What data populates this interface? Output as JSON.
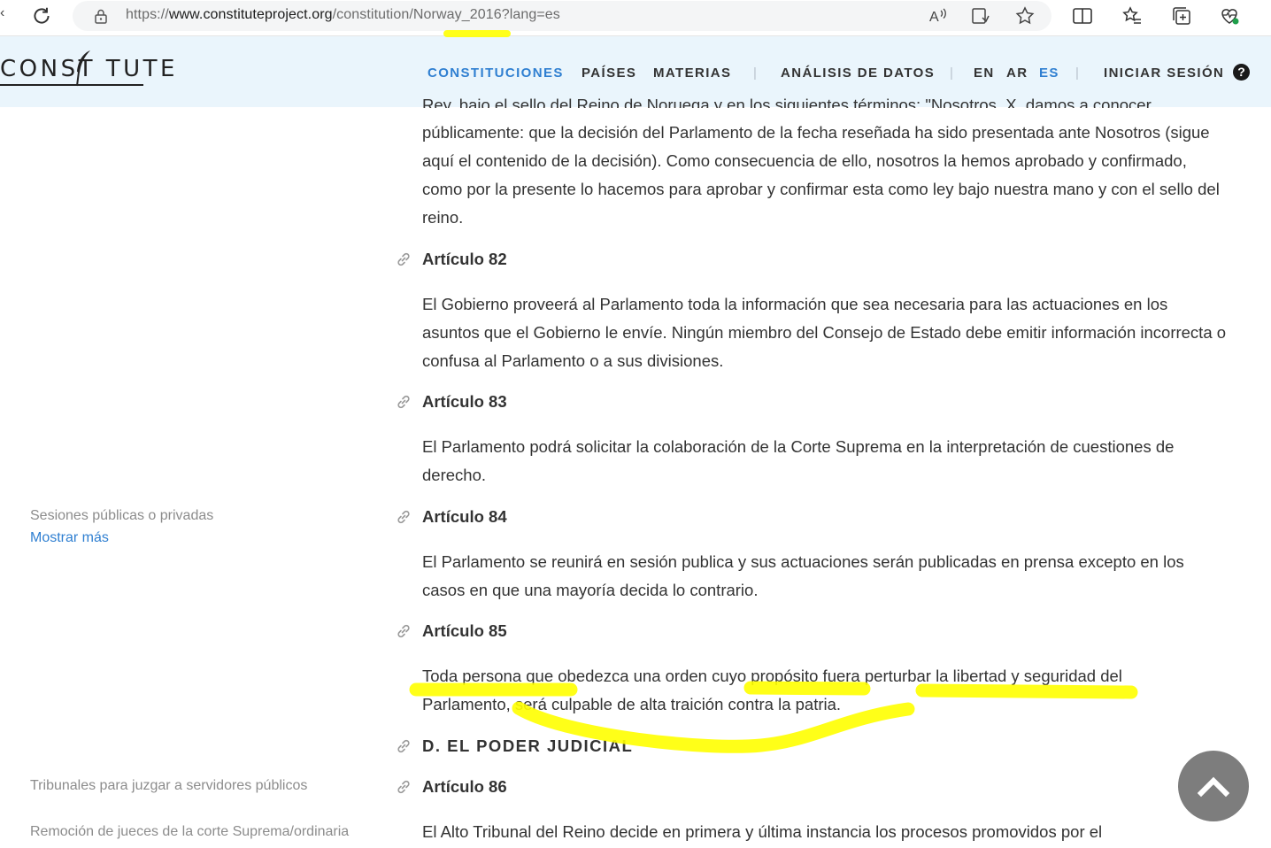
{
  "browser": {
    "url_prefix": "https://",
    "url_host": "www.constituteproject.org",
    "url_path": "/constitution/Norway_2016?lang=es"
  },
  "site": {
    "logo_text": "CONST TUTE",
    "nav": {
      "constituciones": "CONSTITUCIONES",
      "paises": "PAÍSES",
      "materias": "MATERIAS",
      "analisis": "ANÁLISIS DE DATOS",
      "lang_en": "EN",
      "lang_ar": "AR",
      "lang_es": "ES",
      "login": "INICIAR SESIÓN",
      "separator": "|",
      "help": "?"
    }
  },
  "content": {
    "top_partial": "Rey, bajo el sello del Reino de Noruega y en los siguientes términos: \"Nosotros, X, damos a conocer",
    "top_para": "públicamente: que la decisión del Parlamento de la fecha reseñada ha sido presentada ante Nosotros (sigue aquí el contenido de la decisión). Como consecuencia de ello, nosotros la hemos aprobado y confirmado, como por la presente lo hacemos para aprobar y confirmar esta como ley bajo nuestra mano y con el sello del reino.",
    "art82_title": "Artículo 82",
    "art82_text": "El Gobierno proveerá al Parlamento toda la información que sea necesaria para las actuaciones en los asuntos que el Gobierno le envíe. Ningún miembro del Consejo de Estado debe emitir información incorrecta o confusa al Parlamento o a sus divisiones.",
    "art83_title": "Artículo 83",
    "art83_text": "El Parlamento podrá solicitar la colaboración de la Corte Suprema en la interpretación de cuestiones de derecho.",
    "art84_title": "Artículo 84",
    "art84_text": "El Parlamento se reunirá en sesión publica y sus actuaciones serán publicadas en prensa excepto en los casos en que una mayoría decida lo contrario.",
    "art85_title": "Artículo 85",
    "art85_text": "Toda persona que obedezca una orden cuyo propósito fuera perturbar la libertad y seguridad del Parlamento, será culpable de alta traición contra la patria.",
    "section_d": "D. EL PODER JUDICIAL",
    "art86_title": "Artículo 86",
    "art86_text": "El Alto Tribunal del Reino decide en primera y última instancia los procesos promovidos por el"
  },
  "sidebar": {
    "topic1": "Sesiones públicas o privadas",
    "show_more": "Mostrar más",
    "topic2": "Tribunales para juzgar a servidores públicos",
    "topic3": "Remoción de jueces de la corte Suprema/ordinaria"
  },
  "colors": {
    "accent": "#2f7fd1",
    "header_bg": "#eaf5fc",
    "highlight": "#ffff00",
    "scroll_button": "#7d7d7d"
  },
  "icons": [
    "reload-icon",
    "lock-icon",
    "read-aloud-icon",
    "immersive-reader-icon",
    "favorite-star-icon",
    "split-screen-icon",
    "favorites-list-icon",
    "collections-icon",
    "browser-essentials-icon",
    "feather-icon",
    "link-icon",
    "help-icon",
    "chevron-up-icon"
  ]
}
